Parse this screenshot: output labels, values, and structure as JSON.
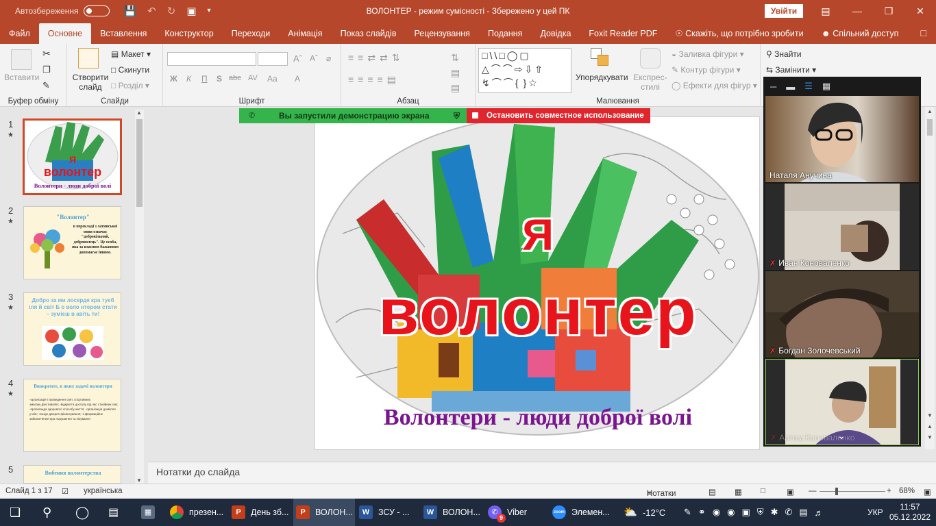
{
  "titlebar": {
    "autosave_label": "Автозбереження",
    "autosave_state": "off",
    "title": "ВОЛОНТЕР  -  режим сумісності  -  Збережено у цей ПК",
    "signin": "Увійти"
  },
  "tabs": [
    "Файл",
    "Основне",
    "Вставлення",
    "Конструктор",
    "Переходи",
    "Анімація",
    "Показ слайдів",
    "Рецензування",
    "Подання",
    "Довідка",
    "Foxit Reader PDF"
  ],
  "tab_active": "Основне",
  "tell_me": "Скажіть, що потрібно зробити",
  "share": "Спільний доступ",
  "ribbon": {
    "clipboard": {
      "paste": "Вставити",
      "label": "Буфер обміну"
    },
    "slides": {
      "new_slide": "Створити слайд",
      "layout": "Макет",
      "reset": "Скинути",
      "section": "Розділ",
      "label": "Слайди"
    },
    "font": {
      "bold": "Ж",
      "italic": "К",
      "underline": "П",
      "strike": "abc",
      "spacing": "AV",
      "case": "Aa",
      "color": "A",
      "label": "Шрифт"
    },
    "paragraph": {
      "label": "Абзац"
    },
    "drawing": {
      "arrange": "Упорядкувати",
      "quick_styles": "Експрес-стилі",
      "fill": "Заливка фігури",
      "outline": "Контур фігури",
      "effects": "Ефекти для фігур",
      "label": "Малювання"
    },
    "editing": {
      "find": "Знайти",
      "replace": "Замінити"
    }
  },
  "thumbnails": [
    {
      "num": "1",
      "title": "Я волонтер",
      "caption": "Волонтери - люди доброї волі"
    },
    {
      "num": "2",
      "title": "\"Волонтер\"",
      "text": "в перекладі з латинської мови означає \"добровільний, доброволець\". Це особа, яка за власним бажанням допомагає іншим."
    },
    {
      "num": "3",
      "text": "Добро за ми лосердя кра туєб іля й світ Б о воло нтером стати – зумієш в авіть ти!"
    },
    {
      "num": "4",
      "title": "Виокремте, в яких задачі волонтери",
      "text": "-організація і проведення свят, спортивних змагань,фестивалів; -відкриття доступу під час стихійних лих; -пропаганда здорового способу життя; -організація дозвілля учнів; -пошук джерел фінансування; -інформаційне забезпечення про порушення та лікування"
    },
    {
      "num": "5",
      "title": "Вибення волонтерства"
    }
  ],
  "screenshare": {
    "started": "Вы запустили демонстрацию экрана",
    "stop": "Остановить совместное использование"
  },
  "slide": {
    "ya": "Я",
    "title": "волонтер",
    "subtitle": "Волонтери - люди доброї волі"
  },
  "notes_placeholder": "Нотатки до слайда",
  "participants": [
    {
      "name": "Наталя Анучина",
      "muted": false
    },
    {
      "name": "Иван Коноваленко",
      "muted": true
    },
    {
      "name": "Богдан Золочевський",
      "muted": true
    },
    {
      "name": "Артем Коноваленко",
      "muted": true
    }
  ],
  "status": {
    "slide_of": "Слайд 1 з 17",
    "language": "українська",
    "notes": "Нотатки",
    "zoom": "68%"
  },
  "taskbar": {
    "items": [
      {
        "label": "презен...",
        "app": "chrome"
      },
      {
        "label": "День зб...",
        "app": "powerpoint"
      },
      {
        "label": "ВОЛОН...",
        "app": "powerpoint"
      },
      {
        "label": "ЗСУ - ...",
        "app": "word"
      },
      {
        "label": "ВОЛОН...",
        "app": "word"
      },
      {
        "label": "Viber",
        "app": "viber",
        "badge": "9"
      },
      {
        "label": "Элемен...",
        "app": "zoom"
      }
    ],
    "weather": "-12°C",
    "lang": "УКР",
    "time": "11:57",
    "date": "05.12.2022"
  },
  "colors": {
    "brand": "#b7472a",
    "share_green": "#34b44a",
    "share_red": "#e0262c",
    "slide_red": "#e8141c",
    "subtitle_purple": "#7a1590"
  }
}
